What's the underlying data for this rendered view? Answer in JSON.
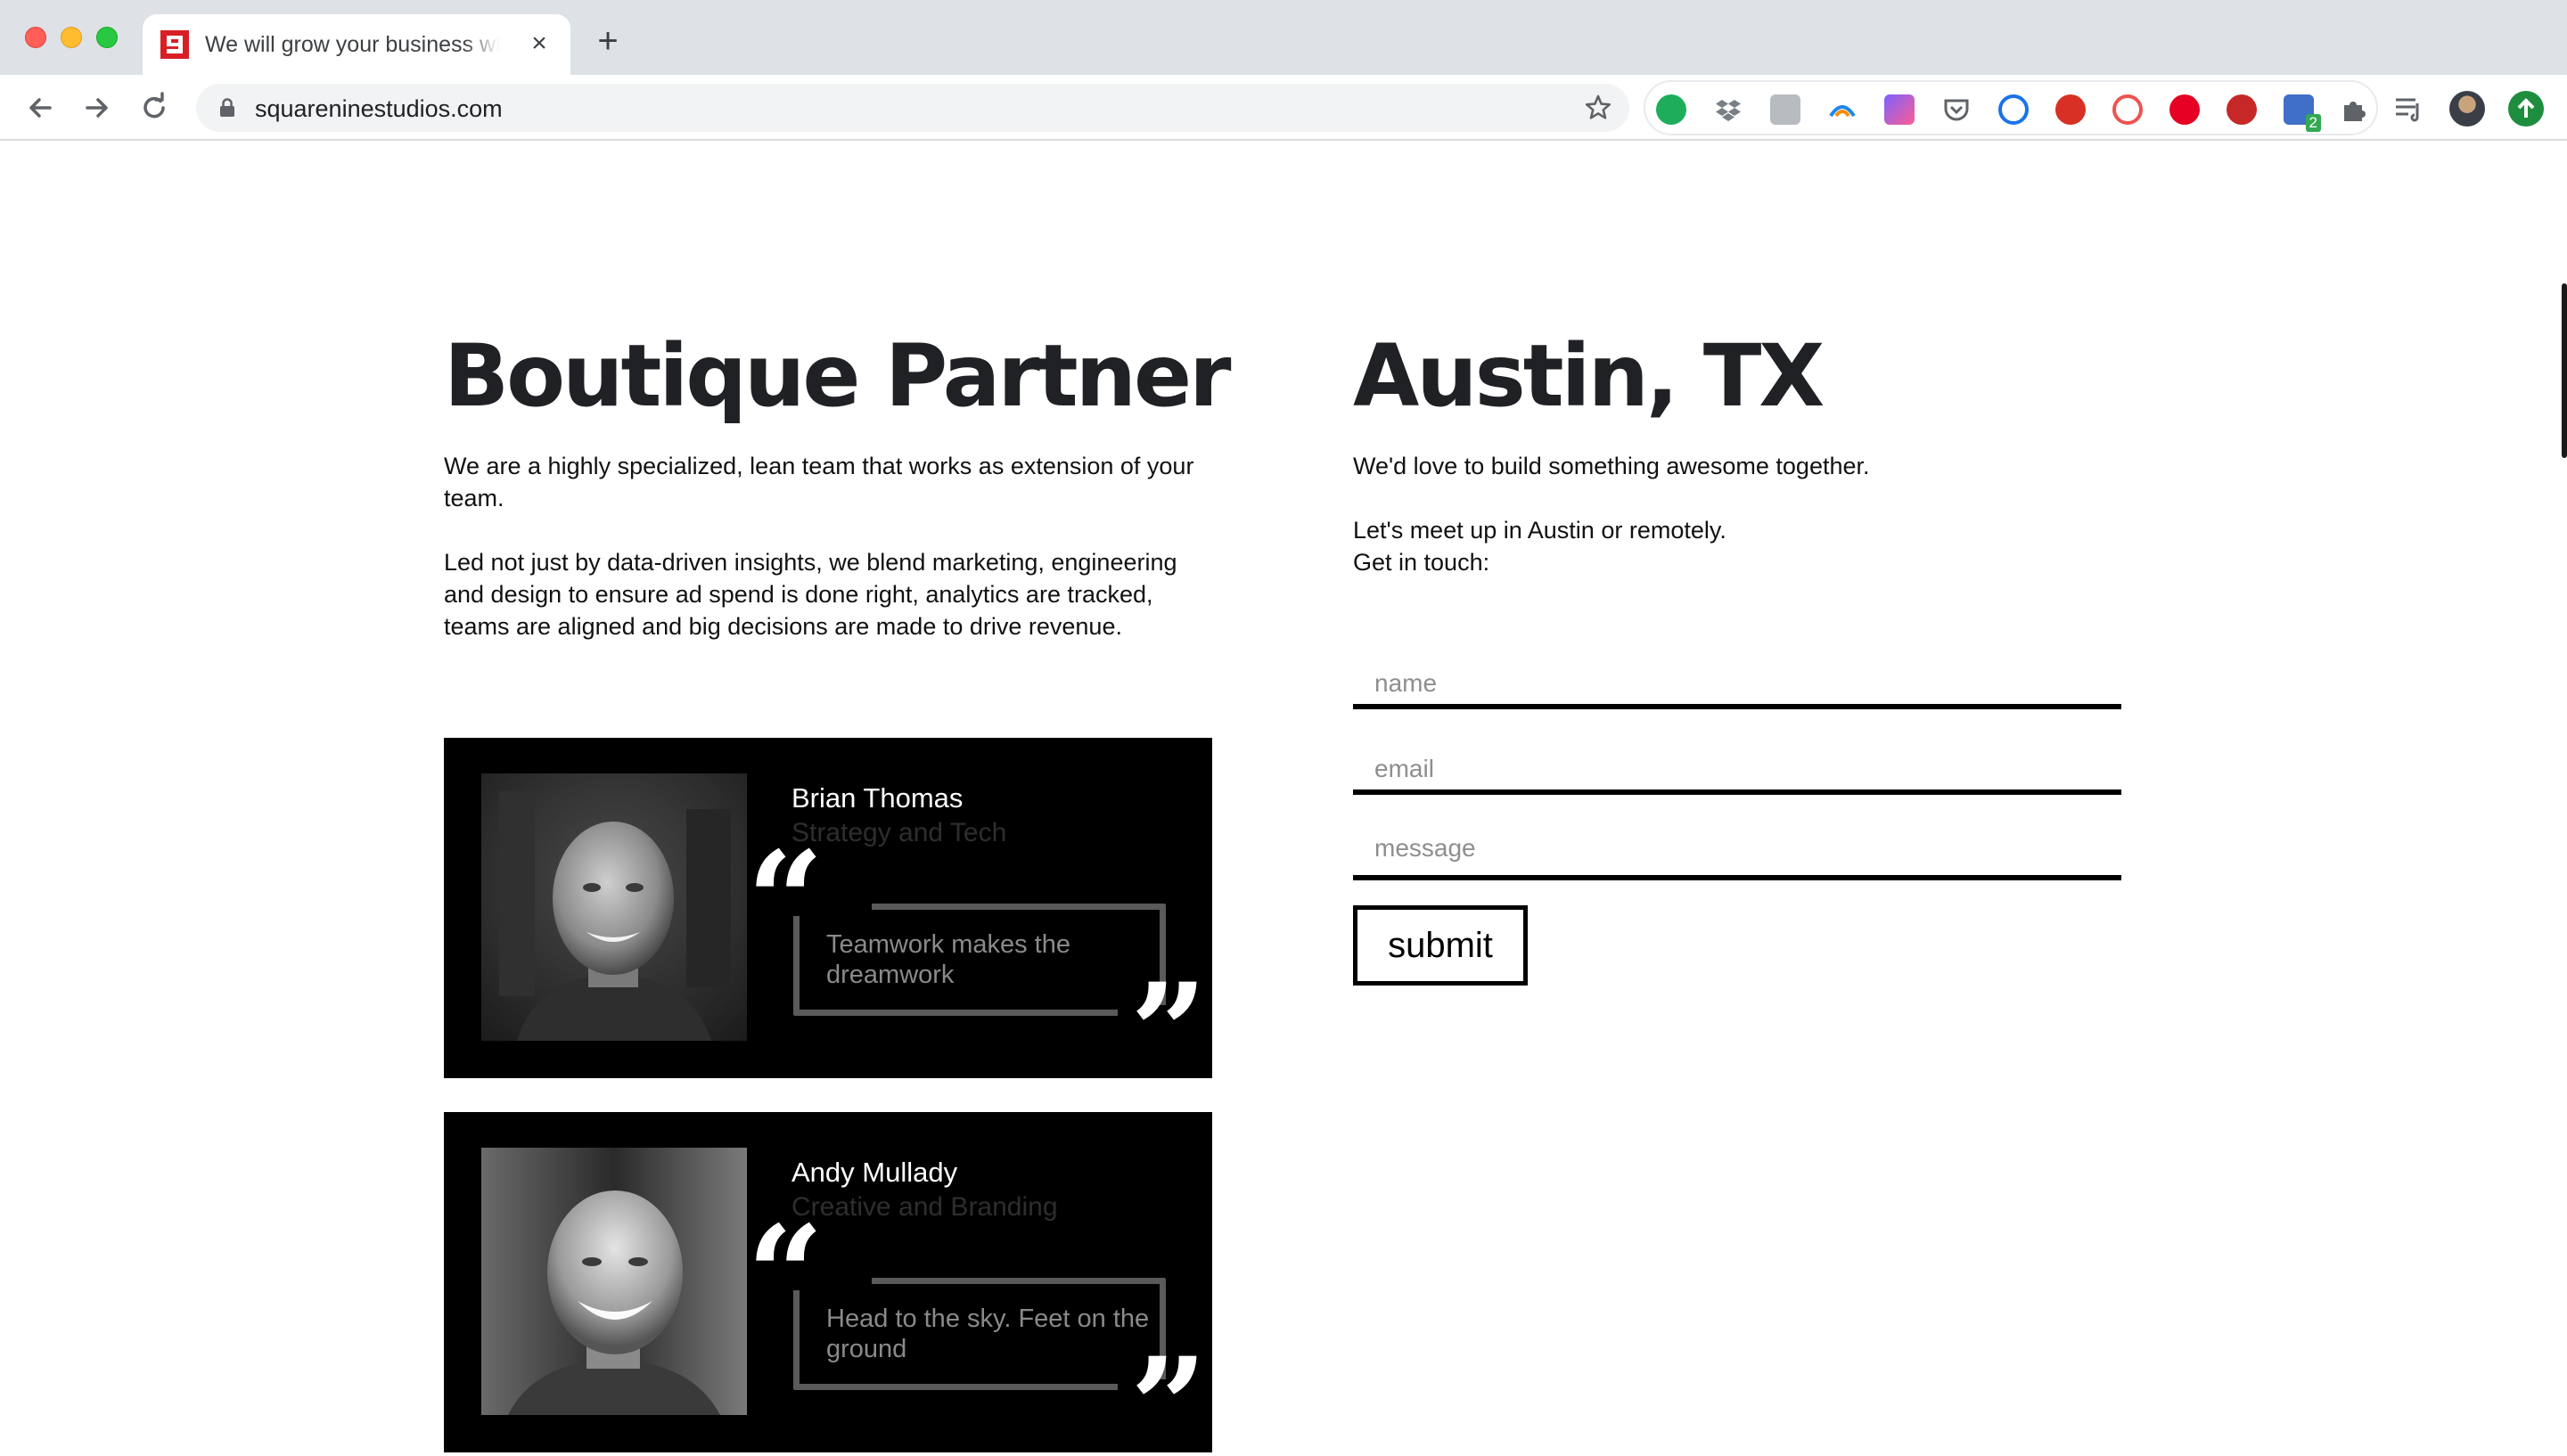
{
  "browser": {
    "tab_title": "We will grow your business when",
    "tab_close": "×",
    "new_tab": "+",
    "url": "squareninestudios.com",
    "extensions": [
      "evernote-icon",
      "dropbox-icon",
      "k-icon",
      "arc-icon",
      "clickup-icon",
      "pocket-icon",
      "1password-icon",
      "stop-icon",
      "spiral-icon",
      "pinterest-icon",
      "chili-icon",
      "devtools-icon",
      "puzzle-icon"
    ],
    "extension_badge": "2"
  },
  "left": {
    "heading": "Boutique Partner",
    "para1": "We are a highly specialized, lean team that works as extension of your team.",
    "para2": "Led not just by data-driven insights, we blend marketing, engineering and design to ensure ad spend is done right, analytics are tracked, teams are aligned and big decisions are made to drive revenue."
  },
  "team": [
    {
      "name": "Brian Thomas",
      "role": "Strategy and Tech",
      "quote": "Teamwork makes the dreamwork"
    },
    {
      "name": "Andy Mullady",
      "role": "Creative and Branding",
      "quote": "Head to the sky. Feet on the ground"
    }
  ],
  "quote_marks": {
    "open": "“",
    "close": "”"
  },
  "right": {
    "heading": "Austin, TX",
    "para1": "We'd love to build something awesome together.",
    "para2": "Let's meet up in Austin or remotely.",
    "para3": "Get in touch:"
  },
  "form": {
    "name_placeholder": "name",
    "email_placeholder": "email",
    "message_placeholder": "message",
    "submit_label": "submit"
  },
  "colors": {
    "brand_red": "#d81f26",
    "card_bg": "#000000",
    "quote_border": "#5a5a5a"
  }
}
